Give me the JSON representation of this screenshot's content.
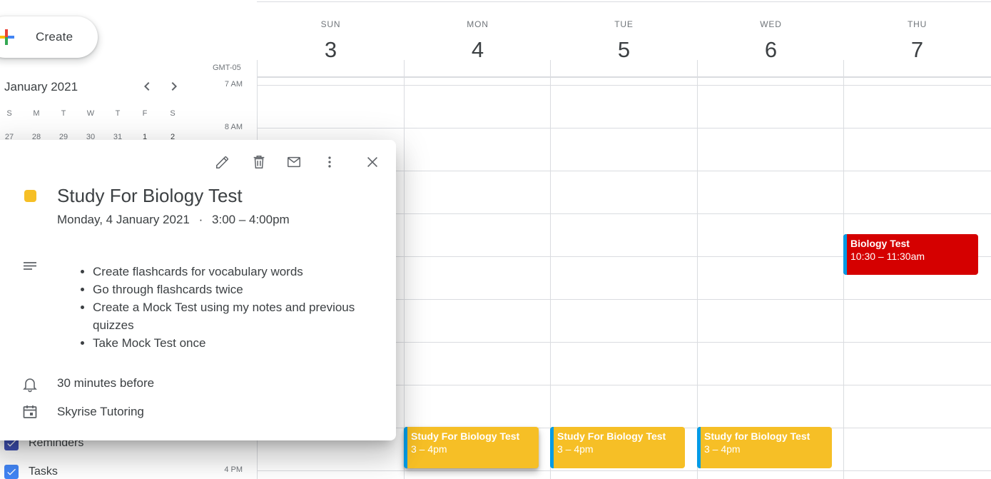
{
  "sidebar": {
    "create_label": "Create",
    "mini_calendar": {
      "month_label": "January 2021",
      "weekdays": [
        "S",
        "M",
        "T",
        "W",
        "T",
        "F",
        "S"
      ],
      "first_row": [
        "27",
        "28",
        "29",
        "30",
        "31",
        "1",
        "2"
      ]
    },
    "calendars": [
      {
        "label": "Reminders",
        "color": "#3f51b5"
      },
      {
        "label": "Tasks",
        "color": "#4285f4"
      }
    ]
  },
  "grid": {
    "timezone": "GMT-05",
    "days": [
      {
        "name": "SUN",
        "num": "3"
      },
      {
        "name": "MON",
        "num": "4"
      },
      {
        "name": "TUE",
        "num": "5"
      },
      {
        "name": "WED",
        "num": "6"
      },
      {
        "name": "THU",
        "num": "7"
      }
    ],
    "hours": [
      "7 AM",
      "8 AM",
      "4 PM"
    ]
  },
  "events": [
    {
      "title": "Study For Biology Test",
      "time": "3 – 4pm",
      "day": "MON",
      "color": "#f6bf26"
    },
    {
      "title": "Study For Biology Test",
      "time": "3 – 4pm",
      "day": "TUE",
      "color": "#f6bf26"
    },
    {
      "title": "Study for Biology Test",
      "time": "3 – 4pm",
      "day": "WED",
      "color": "#f6bf26"
    },
    {
      "title": "Biology Test",
      "time": "10:30 – 11:30am",
      "day": "THU",
      "color": "#d50000"
    }
  ],
  "popup": {
    "title": "Study For Biology Test",
    "date": "Monday, 4 January 2021",
    "separator": "·",
    "time": "3:00 – 4:00pm",
    "color": "#f6bf26",
    "description": [
      "Create flashcards for vocabulary words",
      "Go through flashcards twice",
      "Create a Mock Test using my notes and previous quizzes",
      "Take Mock Test once"
    ],
    "reminder": "30 minutes before",
    "calendar": "Skyrise Tutoring",
    "actions": [
      "edit-icon",
      "delete-icon",
      "email-icon",
      "more-options-icon",
      "close-icon"
    ]
  }
}
